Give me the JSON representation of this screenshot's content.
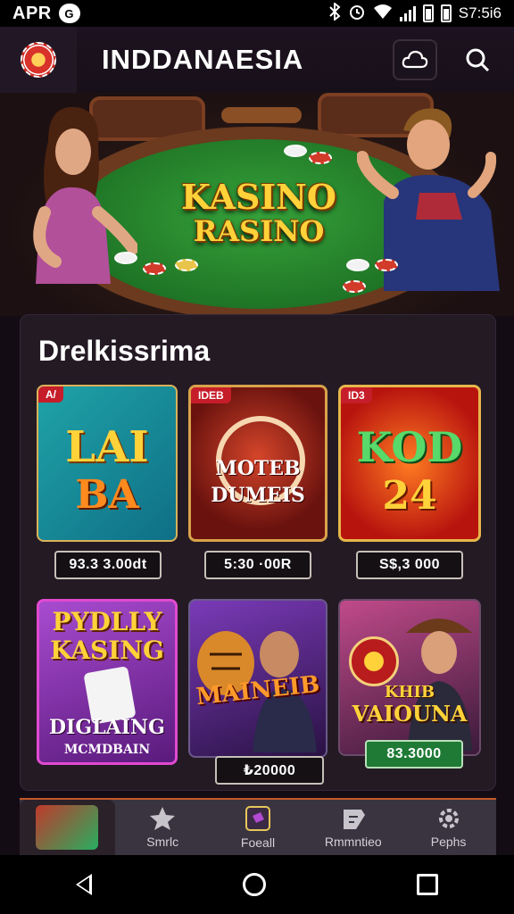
{
  "status_bar": {
    "left_text": "APR",
    "notification_badge": "G",
    "time": "S7:5i6"
  },
  "header": {
    "title": "INDDANAESIA",
    "cloud_icon": "cloud-icon",
    "search_icon": "search-icon"
  },
  "hero": {
    "title_line1": "KASINO",
    "title_line2": "RASINO"
  },
  "games_section": {
    "title": "Drelkissrima",
    "games": [
      {
        "line1": "LAI",
        "line2": "BA",
        "tag": "A/",
        "price": "93.3 3.00dt"
      },
      {
        "line1": "MOTEB",
        "line2": "DUMEIS",
        "tag": "IDEB",
        "price": "5:30 ·00R"
      },
      {
        "line1": "KOD",
        "line2": "24",
        "tag": "ID3",
        "price": "S$,3 000"
      },
      {
        "line1": "PYDLLY",
        "line2": "KASING",
        "line3": "DIGLAING",
        "line4": "MCMDBAIN",
        "price": ""
      },
      {
        "line1": "MAINEIB",
        "price": "₺20000"
      },
      {
        "line1": "KHIB",
        "line2": "VAIOUNA",
        "price": "83.3000"
      }
    ]
  },
  "bottom_nav": {
    "items": [
      {
        "label": "",
        "icon": "casino-avatar-thumb"
      },
      {
        "label": "Smrlc",
        "icon": "star-icon"
      },
      {
        "label": "Foeall",
        "icon": "card-icon"
      },
      {
        "label": "Rmmntieo",
        "icon": "tag-icon"
      },
      {
        "label": "Pephs",
        "icon": "settings-icon"
      }
    ]
  },
  "colors": {
    "accent_orange": "#c55a2a",
    "gold_text": "#ffd23a",
    "felt_green": "#2e8f34"
  }
}
